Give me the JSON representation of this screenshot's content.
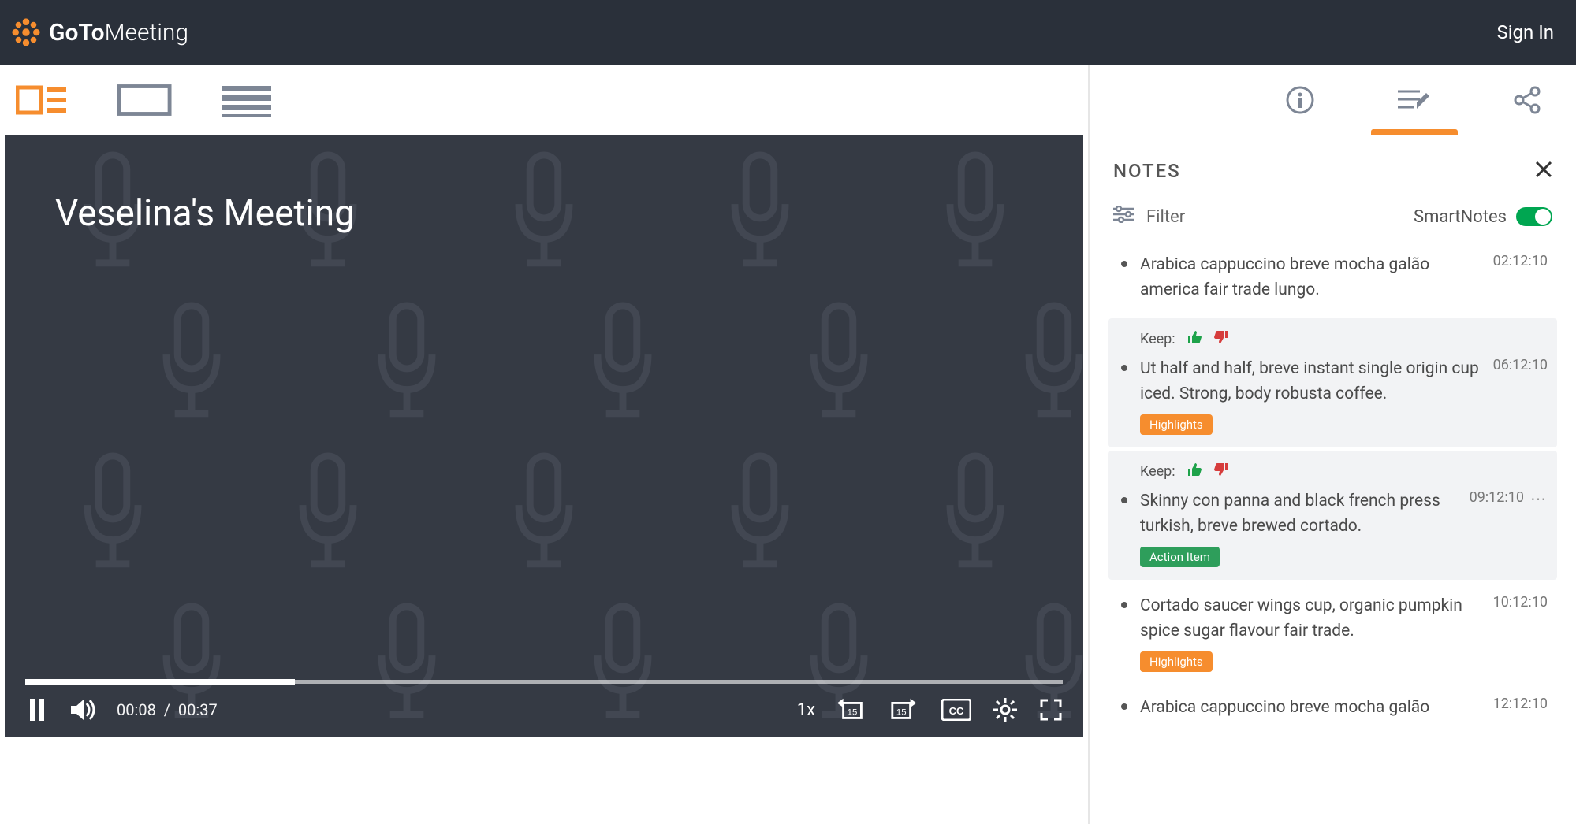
{
  "header": {
    "brand_go_to": "GoTo",
    "brand_meeting": "Meeting",
    "sign_in": "Sign In"
  },
  "video": {
    "title": "Veselina's Meeting",
    "time_current": "00:08",
    "time_separator": "/",
    "time_total": "00:37",
    "speed": "1x",
    "skip_back_seconds": "15",
    "skip_fwd_seconds": "15",
    "progress_percent": 26
  },
  "panel": {
    "tabs": {
      "info": "info",
      "notes": "notes",
      "share": "share",
      "active": "notes"
    },
    "notes_title": "NOTES",
    "filter_label": "Filter",
    "smartnotes_label": "SmartNotes",
    "smartnotes_on": true,
    "keep_label": "Keep:"
  },
  "tags": {
    "highlights": "Highlights",
    "action_item": "Action Item"
  },
  "notes": [
    {
      "text": "Arabica cappuccino breve mocha galão america fair trade lungo.",
      "time": "02:12:10",
      "selected": false,
      "keep": false,
      "tag": null,
      "more": false
    },
    {
      "text": "Ut half and half, breve instant single origin cup iced. Strong, body robusta coffee.",
      "time": "06:12:10",
      "selected": true,
      "keep": true,
      "tag": "highlights",
      "more": false
    },
    {
      "text": "Skinny con panna and black french press turkish, breve brewed cortado.",
      "time": "09:12:10",
      "selected": true,
      "keep": true,
      "tag": "action_item",
      "more": true
    },
    {
      "text": "Cortado saucer wings cup, organic pumpkin spice sugar flavour fair trade.",
      "time": "10:12:10",
      "selected": false,
      "keep": false,
      "tag": "highlights",
      "more": false
    },
    {
      "text": "Arabica cappuccino breve mocha galão",
      "time": "12:12:10",
      "selected": false,
      "keep": false,
      "tag": null,
      "more": false
    }
  ]
}
